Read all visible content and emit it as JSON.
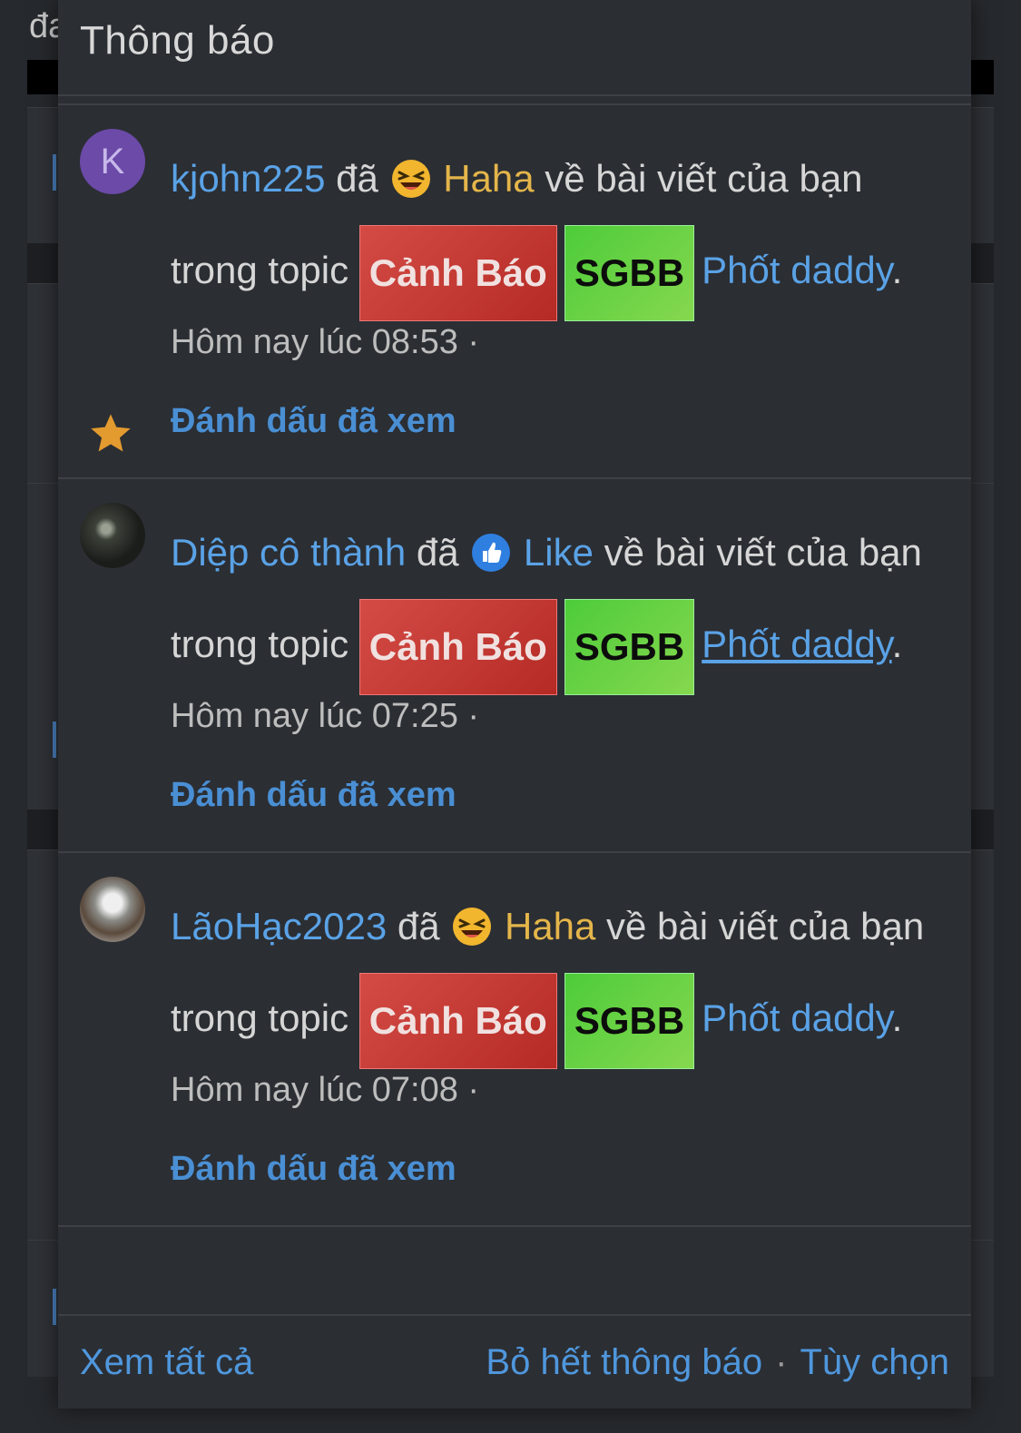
{
  "background": {
    "header_fragment": "đa"
  },
  "popup": {
    "title": "Thông báo",
    "notifications": [
      {
        "user": "kjohn225",
        "verb": "đã",
        "reaction": "Haha",
        "text": "về bài viết của bạn trong topic",
        "tag1": "Cảnh Báo",
        "tag2": "SGBB",
        "topic": "Phốt daddy",
        "time": "Hôm nay lúc 08:53 ·",
        "mark_read": "Đánh dấu đã xem",
        "avatar_letter": "K"
      },
      {
        "user": "Diệp cô thành",
        "verb": "đã",
        "reaction": "Like",
        "text": "về bài viết của bạn trong topic",
        "tag1": "Cảnh Báo",
        "tag2": "SGBB",
        "topic": "Phốt daddy",
        "time": "Hôm nay lúc 07:25 ·",
        "mark_read": "Đánh dấu đã xem"
      },
      {
        "user": "LãoHạc2023",
        "verb": "đã",
        "reaction": "Haha",
        "text": "về bài viết của bạn trong topic",
        "tag1": "Cảnh Báo",
        "tag2": "SGBB",
        "topic": "Phốt daddy",
        "time": "Hôm nay lúc 07:08 ·",
        "mark_read": "Đánh dấu đã xem"
      }
    ],
    "footer": {
      "view_all": "Xem tất cả",
      "dismiss_all": "Bỏ hết thông báo",
      "separator": "·",
      "options": "Tùy chọn"
    }
  },
  "colors": {
    "link": "#5aa2e6",
    "haha": "#e4b54a",
    "tag_red": "#c33a33",
    "tag_green": "#5ed043",
    "star": "#e39a2f"
  }
}
